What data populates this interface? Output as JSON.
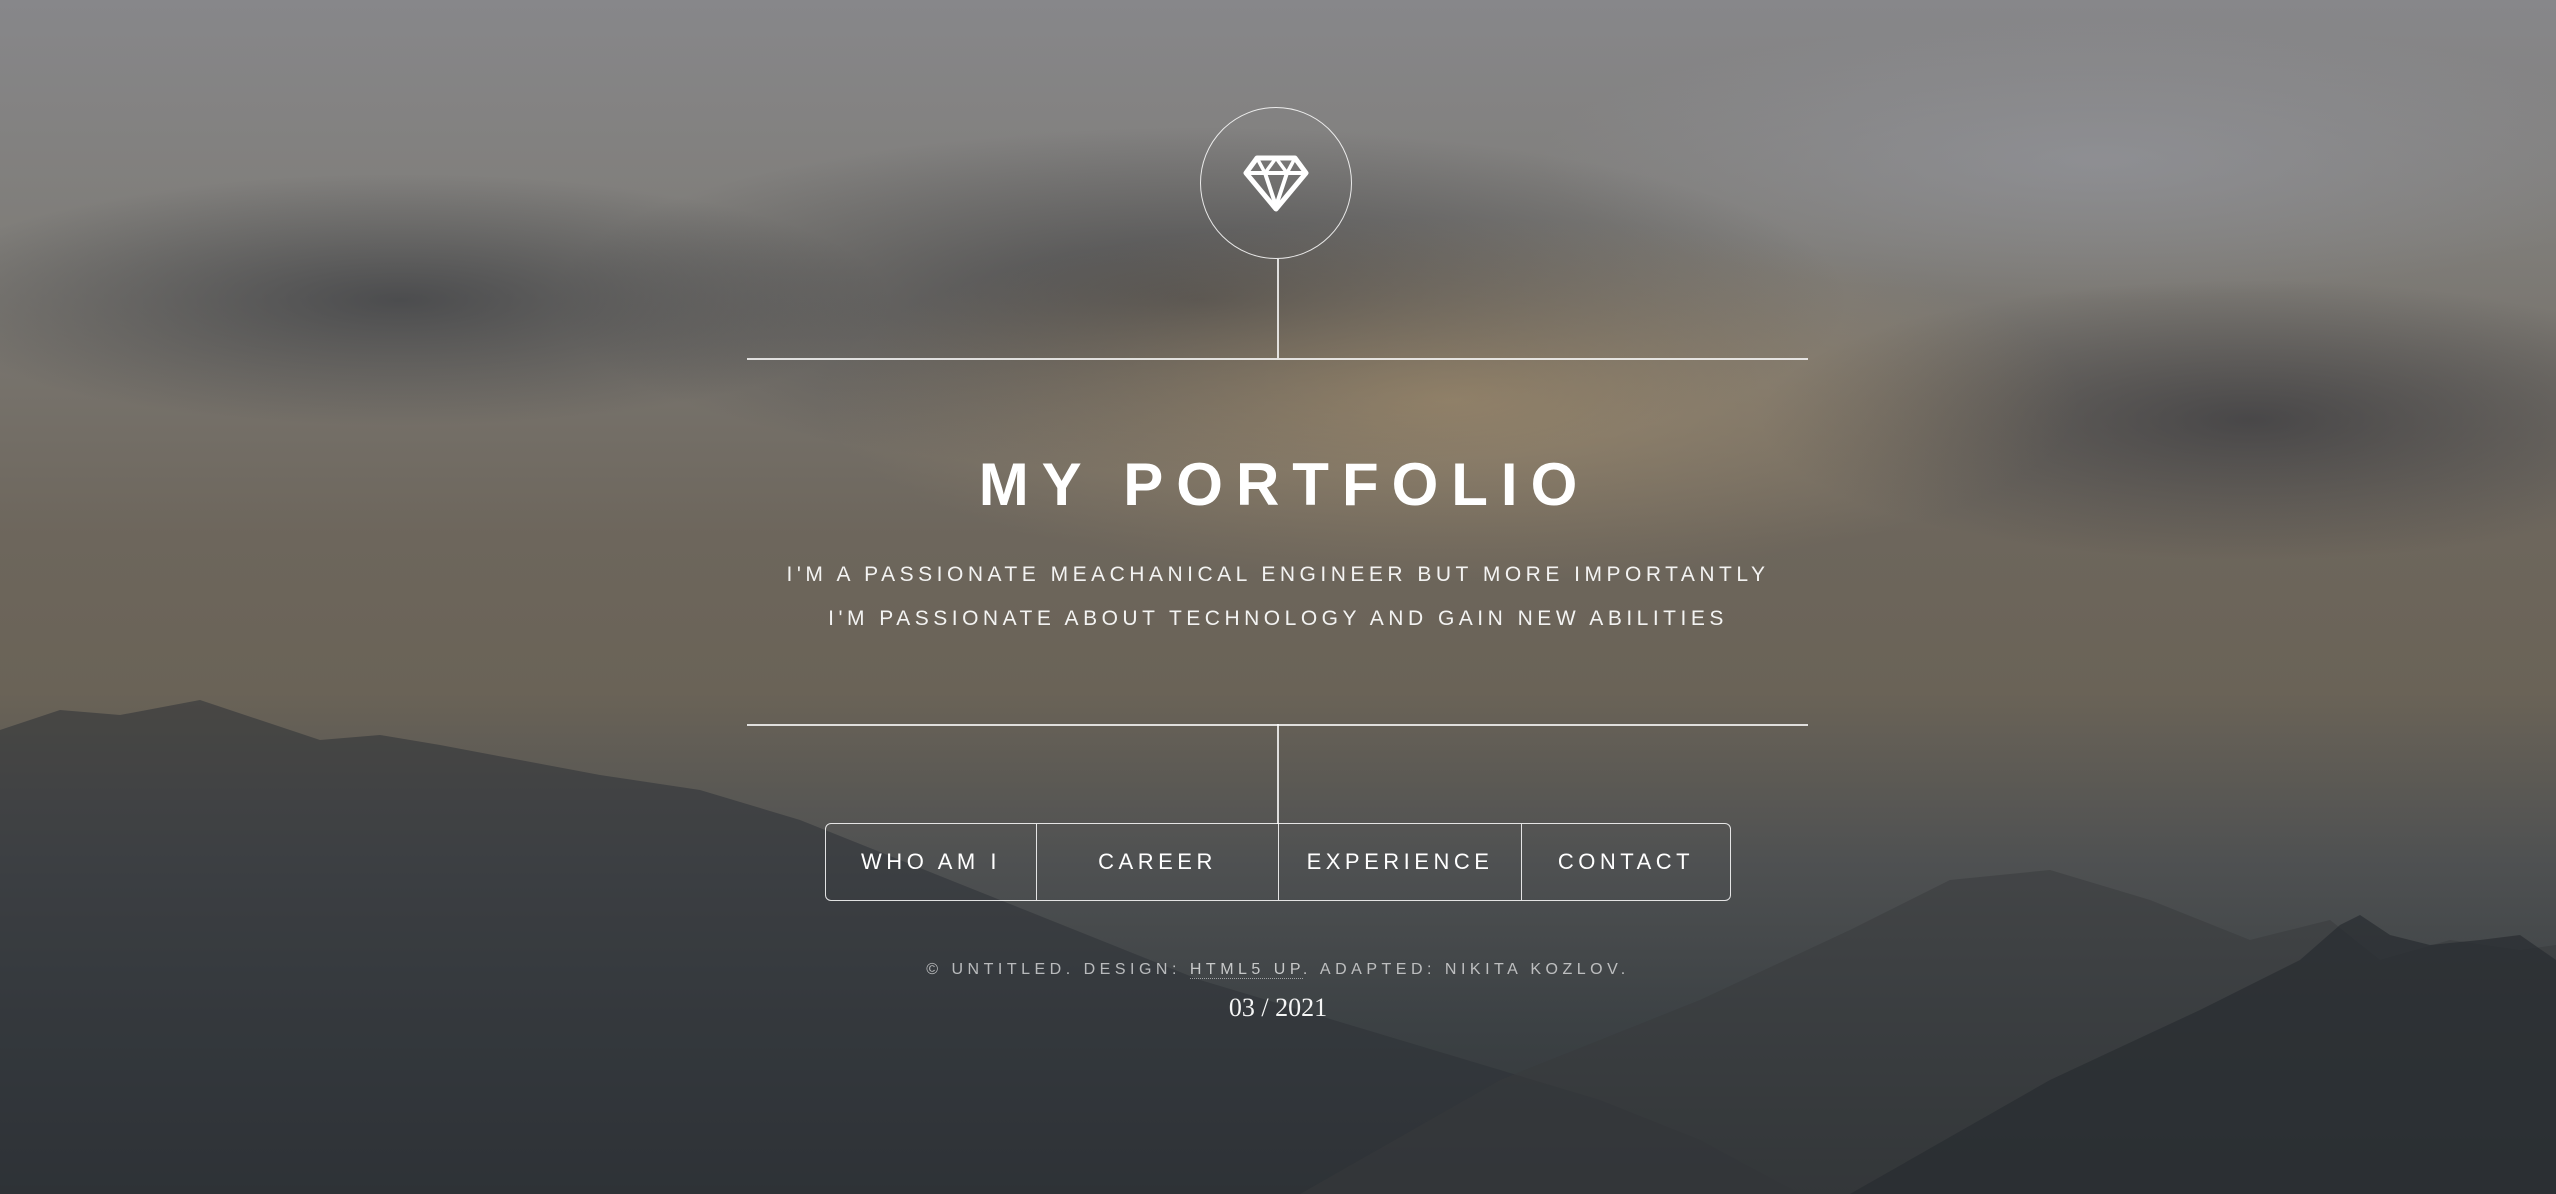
{
  "header": {
    "logo_icon": "diamond-icon"
  },
  "hero": {
    "title": "MY PORTFOLIO",
    "tagline_line1": "I'M A PASSIONATE MEACHANICAL ENGINEER BUT MORE IMPORTANTLY",
    "tagline_line2": "I'M PASSIONATE ABOUT TECHNOLOGY AND GAIN NEW ABILITIES"
  },
  "nav": {
    "items": [
      {
        "label": "WHO AM I"
      },
      {
        "label": "CAREER"
      },
      {
        "label": "EXPERIENCE"
      },
      {
        "label": "CONTACT"
      }
    ]
  },
  "footer": {
    "prefix": "© UNTITLED. DESIGN: ",
    "design_link": "HTML5 UP",
    "suffix": ". ADAPTED: NIKITA KOZLOV.",
    "date": "03 / 2021"
  }
}
